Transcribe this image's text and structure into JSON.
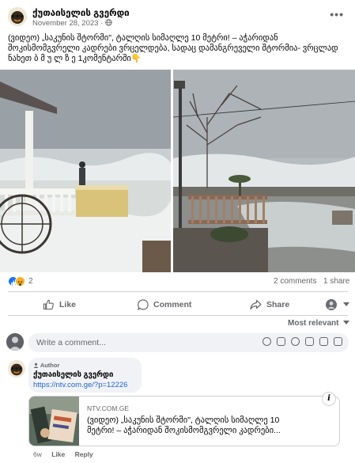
{
  "post": {
    "page_name": "ქუთაისელის გვერდი",
    "date": "November 28, 2023",
    "visibility_icon": "globe-icon",
    "caption_lines": [
      "(ვიდეო) „საკუნის შტორმი\", ტალღის სიმაღლე 10 მეტრი! – აჭარიდან",
      "შოკისმომგვრელი კადრები ვრცელდება, სადაც დამანგრეველი შტორმია- ვრცლად",
      "ნახეთ  ბ მ უ ლ ზ ე   1კომენტარში👇"
    ]
  },
  "reactions": {
    "count": "2",
    "comments": "2 comments",
    "shares": "1 share"
  },
  "actions": {
    "like": "Like",
    "comment": "Comment",
    "share": "Share"
  },
  "sort": "Most relevant",
  "composer": {
    "placeholder": "Write a comment..."
  },
  "comment": {
    "badge": "Author",
    "name": "ქუთაისელის გვერდი",
    "link": "https://ntv.com.ge/?p=12226",
    "preview": {
      "domain": "NTV.COM.GE",
      "title_lines": [
        "(ვიდეო) „საკუნის შტორმი\", ტალღის სიმაღლე 10",
        "მეტრი! – აჭარიდან შოკისმომგვრელი კადრები..."
      ]
    },
    "time": "6w",
    "like_label": "Like",
    "reply_label": "Reply"
  },
  "colors": {
    "accent": "#1877f2",
    "muted": "#65676b",
    "link": "#1d65d6"
  }
}
